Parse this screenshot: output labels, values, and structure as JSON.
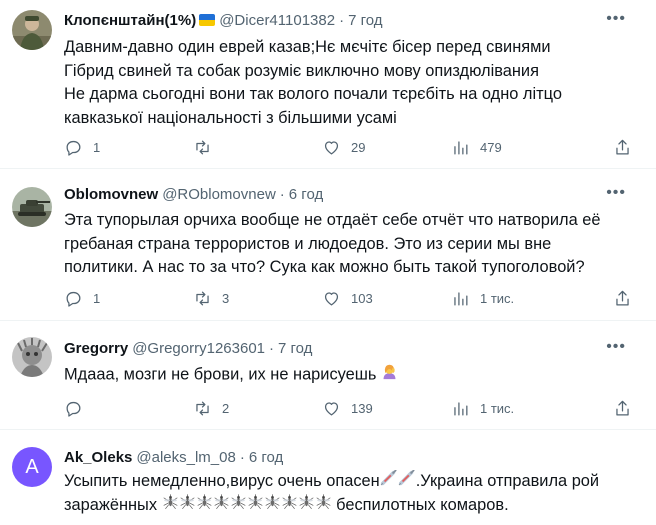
{
  "tweets": [
    {
      "name": "Клопєнштайн(1%)",
      "handle": "@Dicer41101382",
      "dot": "·",
      "time": "7 год",
      "lines": [
        "Давним-давно один еврей казав;Нє мєчітє бісер перед свинями",
        "Гібрид свиней та собак розуміє виключно мову опиздюлівания",
        "Не дарма сьогодні вони так вологo почали тєрєбіть на одно літцо",
        "кавказької національності з більшими усамі"
      ],
      "replies": "1",
      "retweets": "",
      "likes": "29",
      "views": "479"
    },
    {
      "name": "Oblomovnew",
      "handle": "@ROblomovnew",
      "dot": "·",
      "time": "6 год",
      "lines": [
        "Эта тупорылая орчиха вообще не отдаёт себе отчёт что натворила её",
        "гребаная страна террористов и людоедов. Это из серии мы вне",
        "политики. А нас то за что? Сука как можно быть такой тупоголовой?"
      ],
      "replies": "1",
      "retweets": "3",
      "likes": "103",
      "views": "1 тис."
    },
    {
      "name": "Gregorry",
      "handle": "@Gregorry1263601",
      "dot": "·",
      "time": "7 год",
      "lines": [
        "Мдааа, мозги не брови, их не нарисуешь"
      ],
      "replies": "",
      "retweets": "2",
      "likes": "139",
      "views": "1 тис."
    },
    {
      "name": "Ak_Oleks",
      "handle": "@aleks_lm_08",
      "dot": "·",
      "time": "6 год",
      "avatar_letter": "A",
      "line1_a": "Усыпить немедленно,вирус очень опасен",
      "line1_b": ".Украина отправила рой",
      "line2_a": "заражённых",
      "line2_b": "беспилотных комаров."
    }
  ],
  "icons": {
    "more": "more-icon",
    "reply": "reply-icon",
    "retweet": "retweet-icon",
    "like": "heart-icon",
    "views": "views-icon",
    "share": "share-icon",
    "emoji_woman": "woman-gesturing-emoji",
    "emoji_syringe": "syringe-emoji",
    "emoji_mosquito": "mosquito-emoji"
  },
  "colors": {
    "text": "#0f1419",
    "secondary": "#536471",
    "border": "#eff3f4",
    "avatar_letter_bg": "#7856ff"
  }
}
